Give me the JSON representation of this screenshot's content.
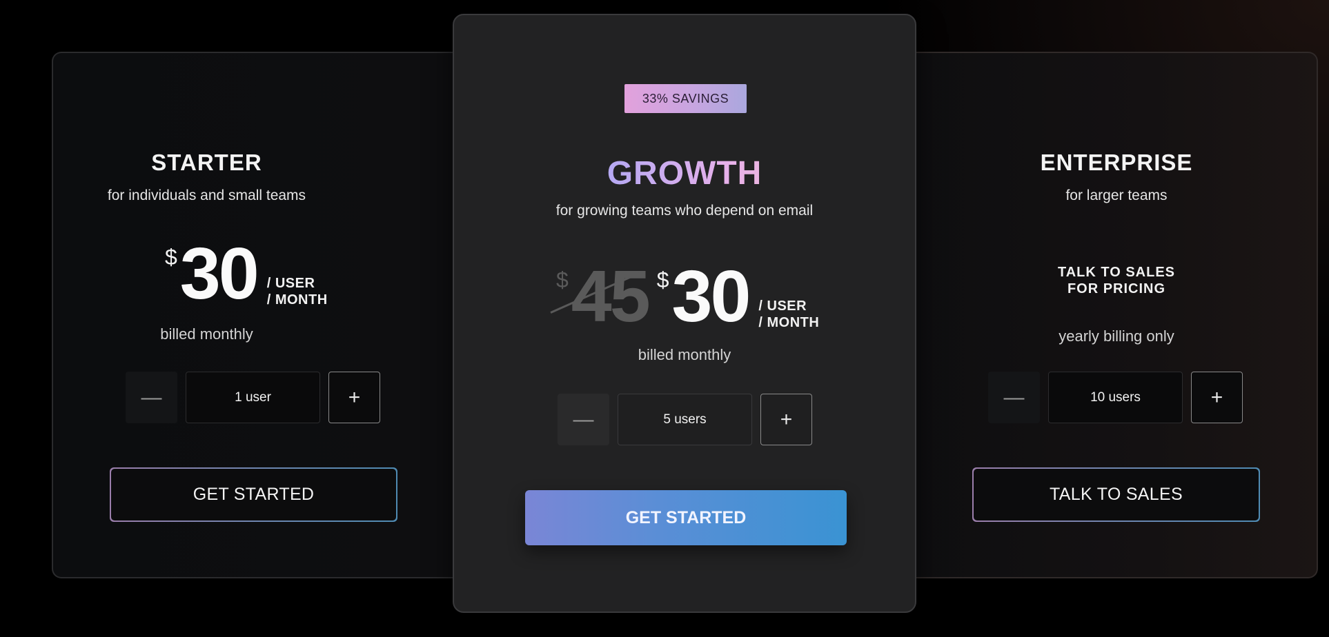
{
  "plans": {
    "starter": {
      "name": "STARTER",
      "tagline": "for individuals and small teams",
      "currency": "$",
      "price": "30",
      "per_user": "/ USER",
      "per_month": "/ MONTH",
      "billing": "billed monthly",
      "quantity": "1 user",
      "minus": "—",
      "plus": "+",
      "cta": "GET STARTED"
    },
    "growth": {
      "badge": "33% SAVINGS",
      "name": "GROWTH",
      "tagline": "for growing teams who depend on email",
      "currency": "$",
      "old_price": "45",
      "price": "30",
      "per_user": "/ USER",
      "per_month": "/ MONTH",
      "billing": "billed monthly",
      "quantity": "5 users",
      "minus": "—",
      "plus": "+",
      "cta": "GET STARTED"
    },
    "enterprise": {
      "name": "ENTERPRISE",
      "tagline": "for larger teams",
      "pricing_line1": "TALK TO SALES",
      "pricing_line2": "FOR PRICING",
      "billing": "yearly billing only",
      "quantity": "10 users",
      "minus": "—",
      "plus": "+",
      "cta": "TALK TO SALES"
    }
  },
  "colors": {
    "cta_gradient_start": "#7a86d6",
    "cta_gradient_end": "#3a93d3",
    "badge_gradient_start": "#e2a1dc",
    "badge_gradient_end": "#aaa7dd",
    "growth_title_gradient": [
      "#8fb3f7",
      "#e8b1ea",
      "#f4c3b3"
    ]
  }
}
